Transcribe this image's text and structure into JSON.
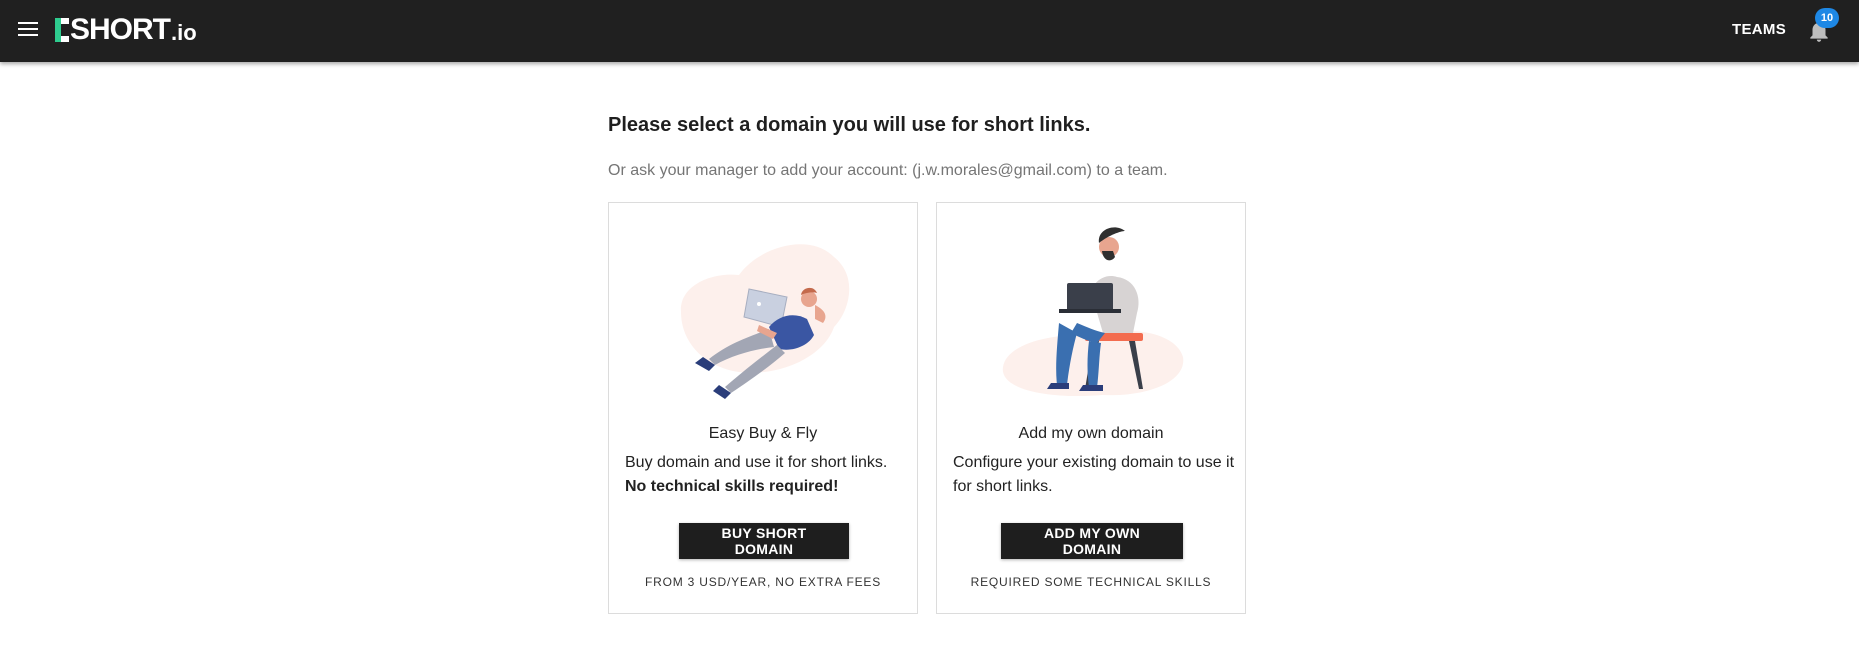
{
  "header": {
    "logo_text": "SHORT",
    "logo_suffix": ".io",
    "teams_label": "TEAMS",
    "notification_count": "10"
  },
  "main": {
    "title": "Please select a domain you will use for short links.",
    "subtitle": "Or ask your manager to add your account: (j.w.morales@gmail.com) to a team."
  },
  "cards": [
    {
      "title": "Easy Buy & Fly",
      "description": "Buy domain and use it for short links.",
      "emphasis": "No technical skills required!",
      "button_label": "BUY SHORT DOMAIN",
      "note": "FROM 3 USD/YEAR, NO EXTRA FEES"
    },
    {
      "title": "Add my own domain",
      "description": "Configure your existing domain to use it for short links.",
      "button_label": "ADD MY OWN DOMAIN",
      "note": "REQUIRED SOME TECHNICAL SKILLS"
    }
  ],
  "colors": {
    "topbar": "#202020",
    "accent_green": "#2ecc8f",
    "badge_blue": "#1e88e5",
    "button_dark": "#1e1e1e"
  },
  "icons": {
    "menu": "menu-icon",
    "bell": "bell-icon"
  }
}
